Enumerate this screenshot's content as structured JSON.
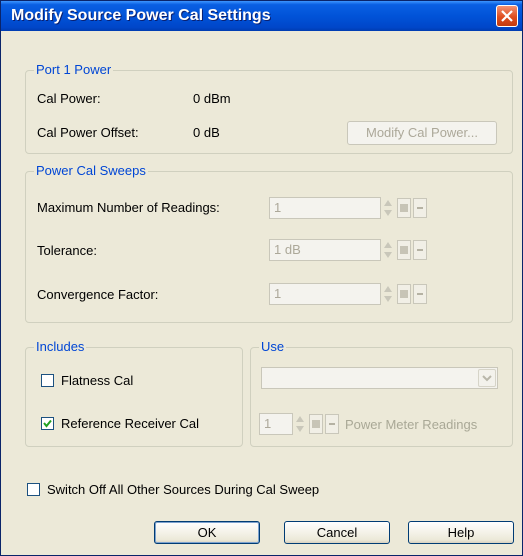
{
  "window": {
    "title": "Modify Source Power Cal Settings"
  },
  "port1": {
    "legend": "Port 1 Power",
    "cal_power_label": "Cal Power:",
    "cal_power_value": "0 dBm",
    "offset_label": "Cal Power Offset:",
    "offset_value": "0 dB",
    "modify_button": "Modify Cal Power..."
  },
  "sweeps": {
    "legend": "Power Cal Sweeps",
    "max_readings_label": "Maximum Number of Readings:",
    "max_readings_value": "1",
    "tolerance_label": "Tolerance:",
    "tolerance_value": "1 dB",
    "convergence_label": "Convergence Factor:",
    "convergence_value": "1"
  },
  "includes": {
    "legend": "Includes",
    "flatness_label": "Flatness Cal",
    "flatness_checked": false,
    "refrx_label": "Reference Receiver Cal",
    "refrx_checked": true
  },
  "use": {
    "legend": "Use",
    "combo_value": "",
    "readings_value": "1",
    "readings_label": "Power Meter Readings"
  },
  "switch_off": {
    "label": "Switch Off All Other Sources During Cal Sweep",
    "checked": false
  },
  "buttons": {
    "ok": "OK",
    "cancel": "Cancel",
    "help": "Help"
  },
  "colors": {
    "title_bar": "#0153d8",
    "group_legend": "#0046d5",
    "dialog_bg": "#ece9d8"
  }
}
